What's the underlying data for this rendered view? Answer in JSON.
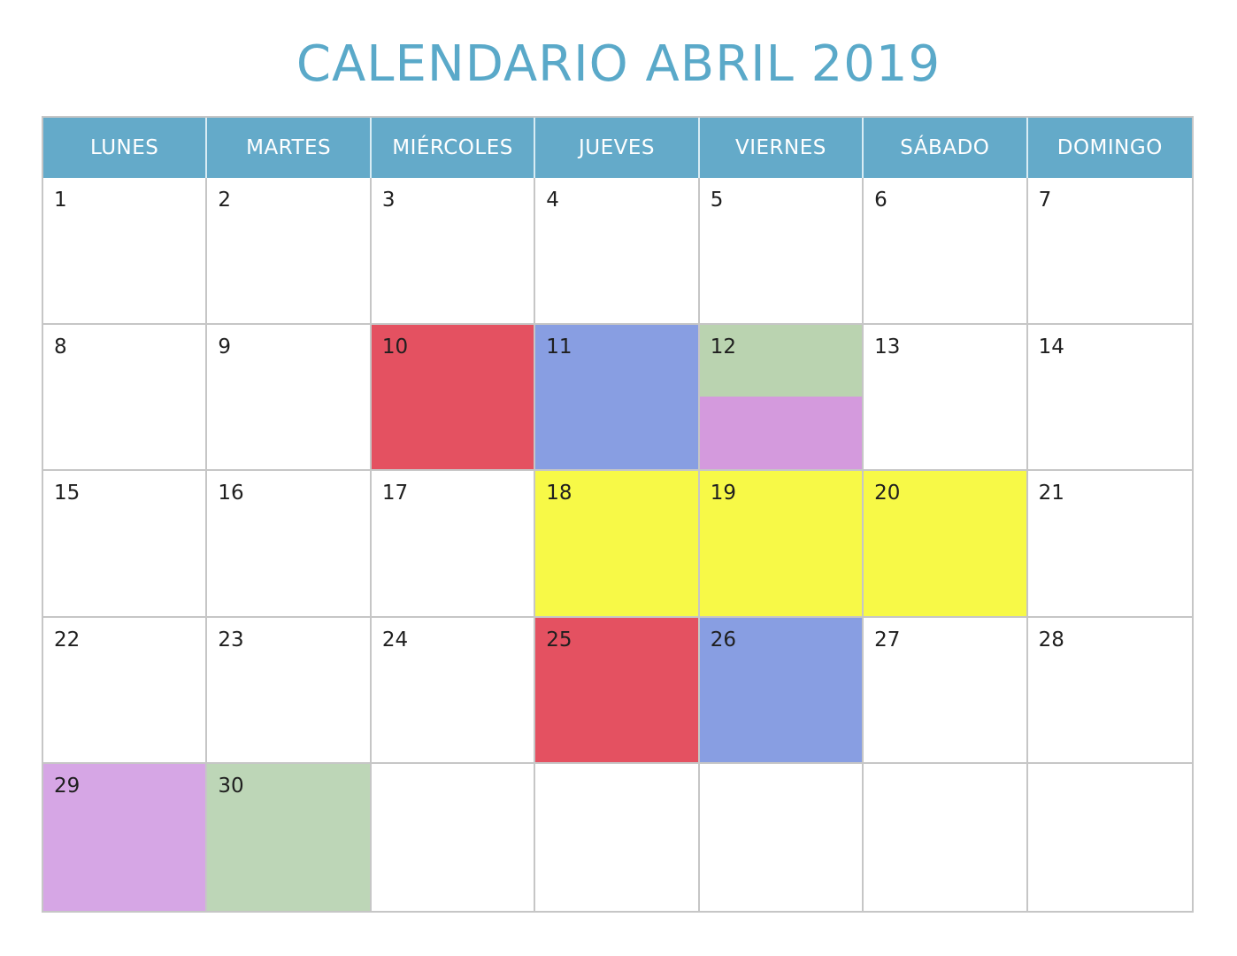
{
  "title": "CALENDARIO ABRIL 2019",
  "colors": {
    "title": "#5aa9c9",
    "header_bg": "#64aac9",
    "header_text": "#ffffff",
    "grid_border": "#c6c6c6",
    "red": "#e45161",
    "blue": "#889ee2",
    "green": "#bad3b0",
    "purple": "#d49add",
    "yellow": "#f7f947"
  },
  "weekdays": [
    "LUNES",
    "MARTES",
    "MIÉRCOLES",
    "JUEVES",
    "VIERNES",
    "SÁBADO",
    "DOMINGO"
  ],
  "weeks": [
    [
      {
        "day": "1",
        "color": ""
      },
      {
        "day": "2",
        "color": ""
      },
      {
        "day": "3",
        "color": ""
      },
      {
        "day": "4",
        "color": ""
      },
      {
        "day": "5",
        "color": ""
      },
      {
        "day": "6",
        "color": ""
      },
      {
        "day": "7",
        "color": ""
      }
    ],
    [
      {
        "day": "8",
        "color": ""
      },
      {
        "day": "9",
        "color": ""
      },
      {
        "day": "10",
        "color": "#e45161"
      },
      {
        "day": "11",
        "color": "#889ee2"
      },
      {
        "day": "12",
        "color": "#bad3b0",
        "color_bottom": "#d49add"
      },
      {
        "day": "13",
        "color": ""
      },
      {
        "day": "14",
        "color": ""
      }
    ],
    [
      {
        "day": "15",
        "color": ""
      },
      {
        "day": "16",
        "color": ""
      },
      {
        "day": "17",
        "color": ""
      },
      {
        "day": "18",
        "color": "#f7f947"
      },
      {
        "day": "19",
        "color": "#f7f947"
      },
      {
        "day": "20",
        "color": "#f7f947"
      },
      {
        "day": "21",
        "color": ""
      }
    ],
    [
      {
        "day": "22",
        "color": ""
      },
      {
        "day": "23",
        "color": ""
      },
      {
        "day": "24",
        "color": ""
      },
      {
        "day": "25",
        "color": "#e45161"
      },
      {
        "day": "26",
        "color": "#889ee2"
      },
      {
        "day": "27",
        "color": ""
      },
      {
        "day": "28",
        "color": ""
      }
    ],
    [
      {
        "day": "29",
        "color": "#d6a6e5"
      },
      {
        "day": "30",
        "color": "#bdd6b7"
      },
      {
        "day": "",
        "color": ""
      },
      {
        "day": "",
        "color": ""
      },
      {
        "day": "",
        "color": ""
      },
      {
        "day": "",
        "color": ""
      },
      {
        "day": "",
        "color": ""
      }
    ]
  ]
}
